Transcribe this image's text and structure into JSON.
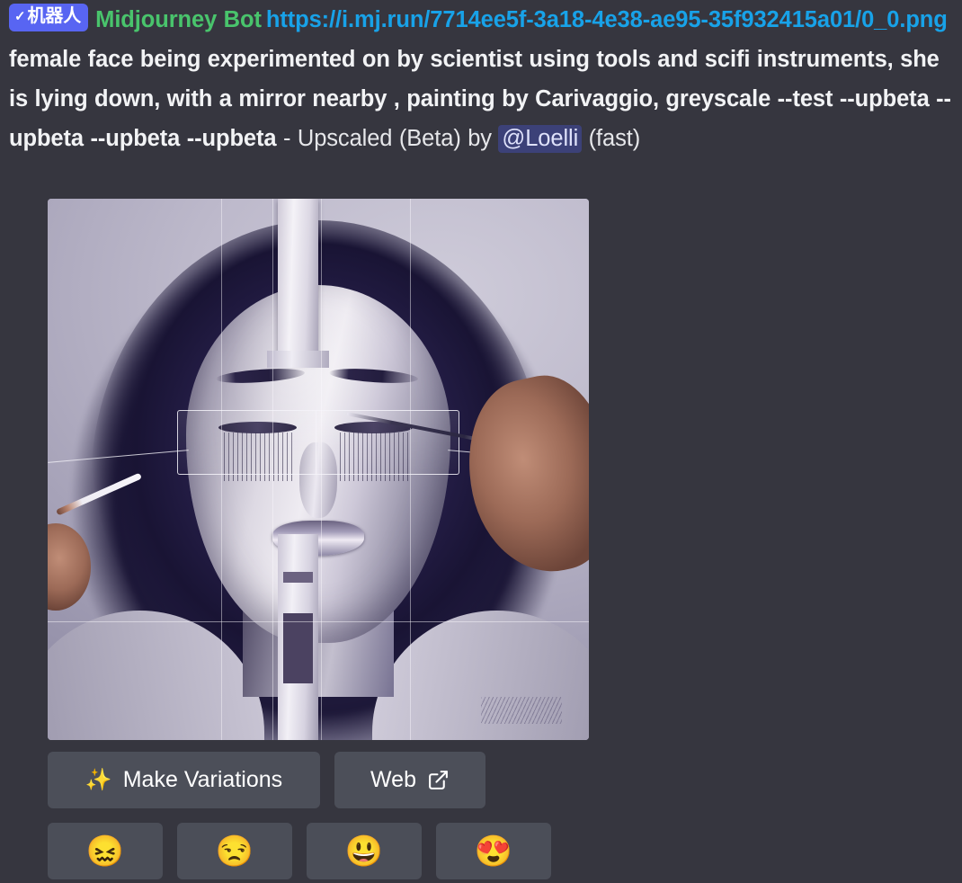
{
  "message": {
    "bot_badge": {
      "check": "✓",
      "label": "机器人"
    },
    "username": "Midjourney Bot",
    "link": "https://i.mj.run/7714ee5f-3a18-4e38-ae95-35f932415a01/0_0.png",
    "prompt": "female face being experimented on by scientist using tools and scifi instruments, she is lying down, with a mirror nearby , painting by Carivaggio, greyscale --test --upbeta --upbeta --upbeta --upbeta",
    "separator": " - ",
    "job_status": "Upscaled (Beta) by ",
    "mention": "@Loelli",
    "speed": " (fast)"
  },
  "attachment": {
    "alt": "Greyscale painting of a female face with scientific instruments and hands holding tools"
  },
  "actions": [
    {
      "name": "make-variations",
      "label": "Make Variations",
      "icon": "sparkles-icon",
      "glyph": "✨"
    },
    {
      "name": "web",
      "label": "Web",
      "icon": "external-link-icon"
    }
  ],
  "reactions": [
    {
      "name": "confounded-face",
      "glyph": "😖"
    },
    {
      "name": "unamused-face",
      "glyph": "😒"
    },
    {
      "name": "grinning-face",
      "glyph": "😃"
    },
    {
      "name": "heart-eyes-face",
      "glyph": "😍"
    }
  ],
  "colors": {
    "background": "#36363f",
    "username": "#49c46c",
    "link": "#18a2e8",
    "badge": "#5865f2",
    "button": "#4c4f59",
    "mention_bg": "#3c4178",
    "text": "#f2f3f5"
  }
}
